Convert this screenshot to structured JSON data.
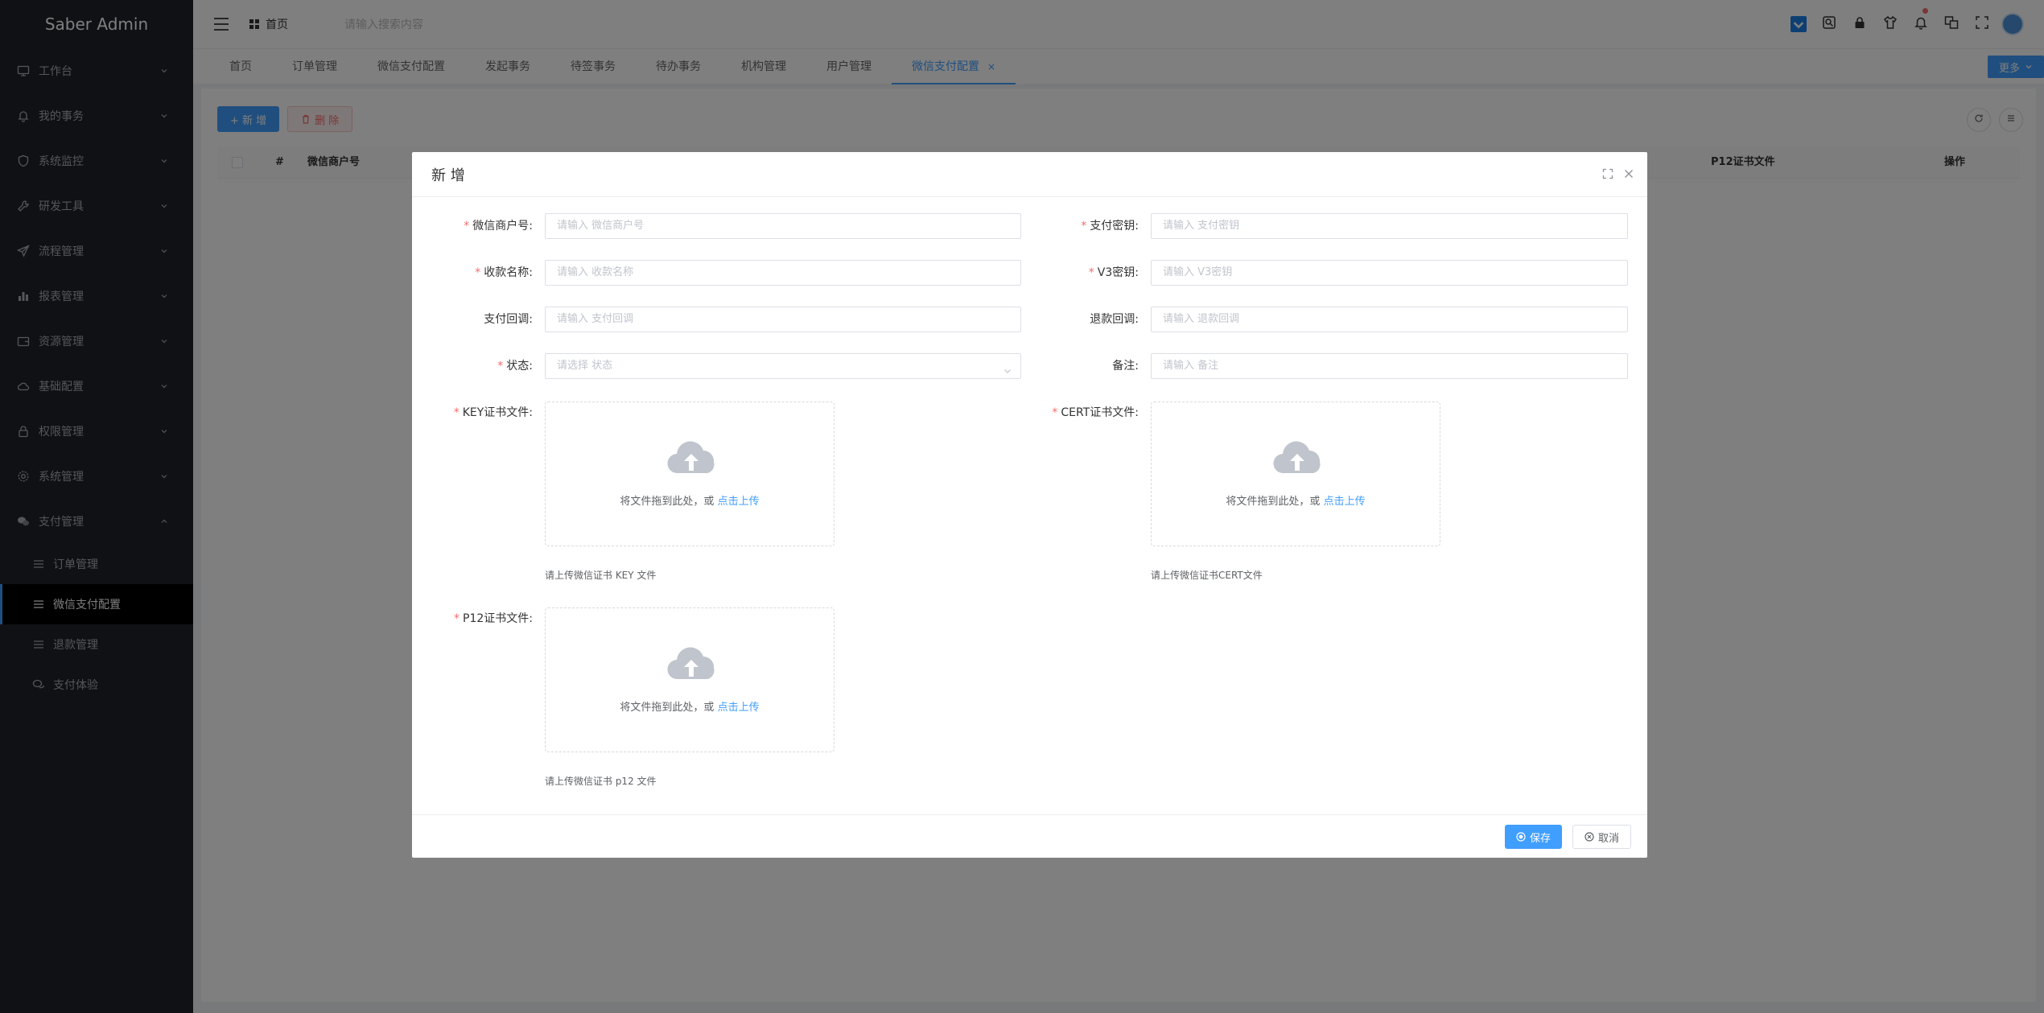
{
  "app": {
    "title": "Saber Admin"
  },
  "sidebar": {
    "items": [
      {
        "label": "工作台",
        "icon": "monitor-icon"
      },
      {
        "label": "我的事务",
        "icon": "bell-icon"
      },
      {
        "label": "系统监控",
        "icon": "shield-icon"
      },
      {
        "label": "研发工具",
        "icon": "wrench-icon"
      },
      {
        "label": "流程管理",
        "icon": "send-icon"
      },
      {
        "label": "报表管理",
        "icon": "bar-chart-icon"
      },
      {
        "label": "资源管理",
        "icon": "wallet-icon"
      },
      {
        "label": "基础配置",
        "icon": "cloud-icon"
      },
      {
        "label": "权限管理",
        "icon": "lock-icon"
      },
      {
        "label": "系统管理",
        "icon": "gear-icon"
      },
      {
        "label": "支付管理",
        "icon": "wechat-icon"
      }
    ],
    "sub_items": [
      {
        "label": "订单管理",
        "icon": "list-icon"
      },
      {
        "label": "微信支付配置",
        "icon": "list-icon"
      },
      {
        "label": "退款管理",
        "icon": "list-icon"
      },
      {
        "label": "支付体验",
        "icon": "chat-icon"
      }
    ]
  },
  "topbar": {
    "home_label": "首页",
    "search_placeholder": "请输入搜索内容"
  },
  "tabs": {
    "items": [
      "首页",
      "订单管理",
      "微信支付配置",
      "发起事务",
      "待签事务",
      "待办事务",
      "机构管理",
      "用户管理",
      "微信支付配置"
    ],
    "close": "×",
    "more": "更多"
  },
  "content": {
    "add_label": "+ 新 增",
    "delete_label": "删 除",
    "table_headers": {
      "index": "#",
      "merchant": "微信商户号",
      "p12": "P12证书文件",
      "action": "操作"
    }
  },
  "dialog": {
    "title": "新 增",
    "fields": {
      "merchant_no": {
        "label": "微信商户号:",
        "placeholder": "请输入 微信商户号"
      },
      "pay_secret": {
        "label": "支付密钥:",
        "placeholder": "请输入 支付密钥"
      },
      "payee_name": {
        "label": "收款名称:",
        "placeholder": "请输入 收款名称"
      },
      "v3_secret": {
        "label": "V3密钥:",
        "placeholder": "请输入 V3密钥"
      },
      "pay_callback": {
        "label": "支付回调:",
        "placeholder": "请输入 支付回调"
      },
      "refund_callback": {
        "label": "退款回调:",
        "placeholder": "请输入 退款回调"
      },
      "status": {
        "label": "状态:",
        "placeholder": "请选择 状态"
      },
      "remark": {
        "label": "备注:",
        "placeholder": "请输入 备注"
      },
      "key_file": {
        "label": "KEY证书文件:",
        "tip": "请上传微信证书 KEY 文件"
      },
      "cert_file": {
        "label": "CERT证书文件:",
        "tip": "请上传微信证书CERT文件"
      },
      "p12_file": {
        "label": "P12证书文件:",
        "tip": "请上传微信证书 p12 文件"
      }
    },
    "upload_text": "将文件拖到此处，或",
    "upload_link": "点击上传",
    "save_label": "保存",
    "cancel_label": "取消"
  },
  "colors": {
    "primary": "#409eff",
    "sidebar_bg": "#20222a",
    "danger": "#f56c6c"
  }
}
